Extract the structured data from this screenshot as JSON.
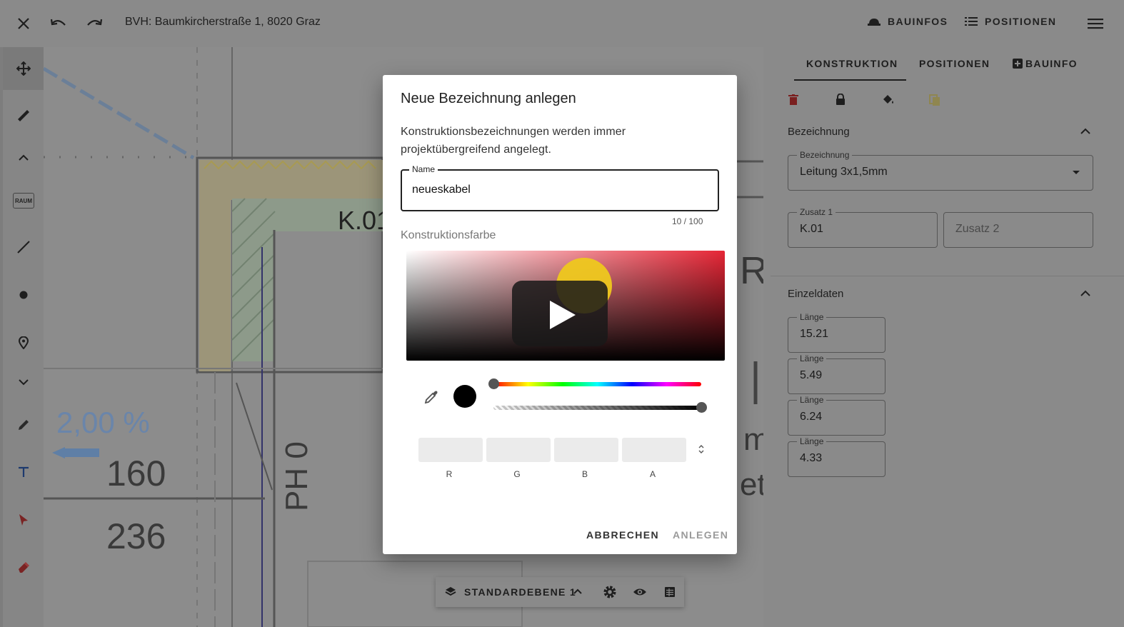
{
  "header": {
    "title": "BVH: Baumkircherstraße 1, 8020 Graz",
    "bauinfos_label": "BAUINFOS",
    "positionen_label": "POSITIONEN"
  },
  "canvas": {
    "label_k01": "K.01",
    "label_percent": "2,00 %",
    "label_160": "160",
    "label_236": "236",
    "label_ph": "PH 0",
    "label_r": "R",
    "label_et": "et",
    "label_m": "m"
  },
  "toolbar": {
    "raum_label": "RAUM"
  },
  "right_panel": {
    "tabs": [
      {
        "label": "KONSTRUKTION"
      },
      {
        "label": "POSITIONEN"
      },
      {
        "label": "BAUINFO"
      }
    ],
    "bezeichnung_section": "Bezeichnung",
    "bezeichnung_field_label": "Bezeichnung",
    "bezeichnung_value": "Leitung 3x1,5mm",
    "zusatz1_label": "Zusatz 1",
    "zusatz1_value": "K.01",
    "zusatz2_placeholder": "Zusatz 2",
    "einzeldaten_section": "Einzeldaten",
    "laengen": [
      {
        "label": "Länge",
        "value": "15.21"
      },
      {
        "label": "Länge",
        "value": "5.49"
      },
      {
        "label": "Länge",
        "value": "6.24"
      },
      {
        "label": "Länge",
        "value": "4.33"
      }
    ]
  },
  "modal": {
    "title": "Neue Bezeichnung anlegen",
    "description": "Konstruktionsbezeichnungen werden immer projektübergreifend angelegt.",
    "name_label": "Name",
    "name_value": "neueskabel",
    "counter": "10 / 100",
    "color_label": "Konstruktionsfarbe",
    "rgba_labels": [
      "R",
      "G",
      "B",
      "A"
    ],
    "cancel_label": "ABBRECHEN",
    "create_label": "ANLEGEN",
    "hue_level": 0,
    "alpha_level": 1,
    "colors": {
      "spectrum_hue": "#e62636",
      "preview": "#000000"
    }
  },
  "layer_bar": {
    "label": "STANDARDEBENE 1"
  }
}
